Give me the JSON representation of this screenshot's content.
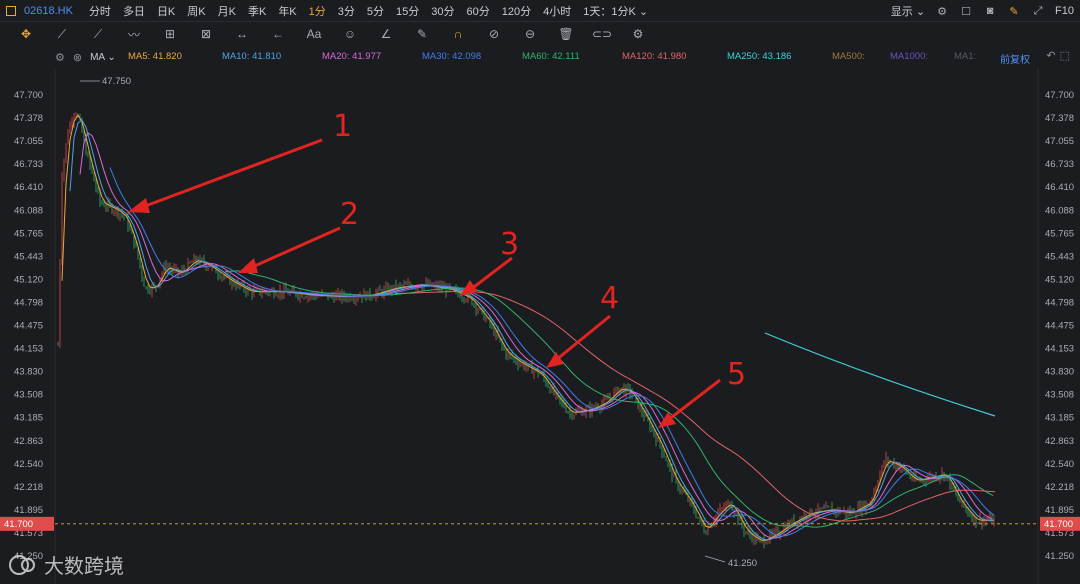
{
  "header": {
    "symbol": "02618.HK",
    "periods": [
      "分时",
      "多日",
      "日K",
      "周K",
      "月K",
      "季K",
      "年K",
      "1分",
      "3分",
      "5分",
      "15分",
      "30分",
      "60分",
      "120分",
      "4小时"
    ],
    "active_period_index": 7,
    "period_select": "1天：1分K",
    "display_label": "显示",
    "f10_label": "F10"
  },
  "ma_bar": {
    "name": "MA",
    "items": [
      {
        "label": "MA5: 41.820",
        "color": "#e8a93b"
      },
      {
        "label": "MA10: 41.810",
        "color": "#4da3e8"
      },
      {
        "label": "MA20: 41.977",
        "color": "#d86bd6"
      },
      {
        "label": "MA30: 42.098",
        "color": "#3f7fe8"
      },
      {
        "label": "MA60: 42.111",
        "color": "#2fb36c"
      },
      {
        "label": "MA120: 41.980",
        "color": "#e06565"
      },
      {
        "label": "MA250: 43.186",
        "color": "#3fd1d8"
      },
      {
        "label": "MA500:",
        "color": "#9c7a3b"
      },
      {
        "label": "MA1000:",
        "color": "#6a55b8"
      },
      {
        "label": "MA1:",
        "color": "#555960"
      }
    ],
    "adjust_label": "前复权"
  },
  "chart": {
    "y_ticks": [
      "47.700",
      "47.378",
      "47.055",
      "46.733",
      "46.410",
      "46.088",
      "45.765",
      "45.443",
      "45.120",
      "44.798",
      "44.475",
      "44.153",
      "43.830",
      "43.508",
      "43.185",
      "42.863",
      "42.540",
      "42.218",
      "41.895",
      "41.573",
      "41.250"
    ],
    "current_price": "41.700",
    "high_label": "47.750",
    "low_label": "41.250",
    "annotations": [
      "1",
      "2",
      "3",
      "4",
      "5"
    ],
    "colors": {
      "up": "#e04b4b",
      "down": "#2fb36c",
      "annotation": "#e0241f",
      "price_line": "#e8a93b"
    }
  },
  "watermark": {
    "text": "大数跨境"
  }
}
